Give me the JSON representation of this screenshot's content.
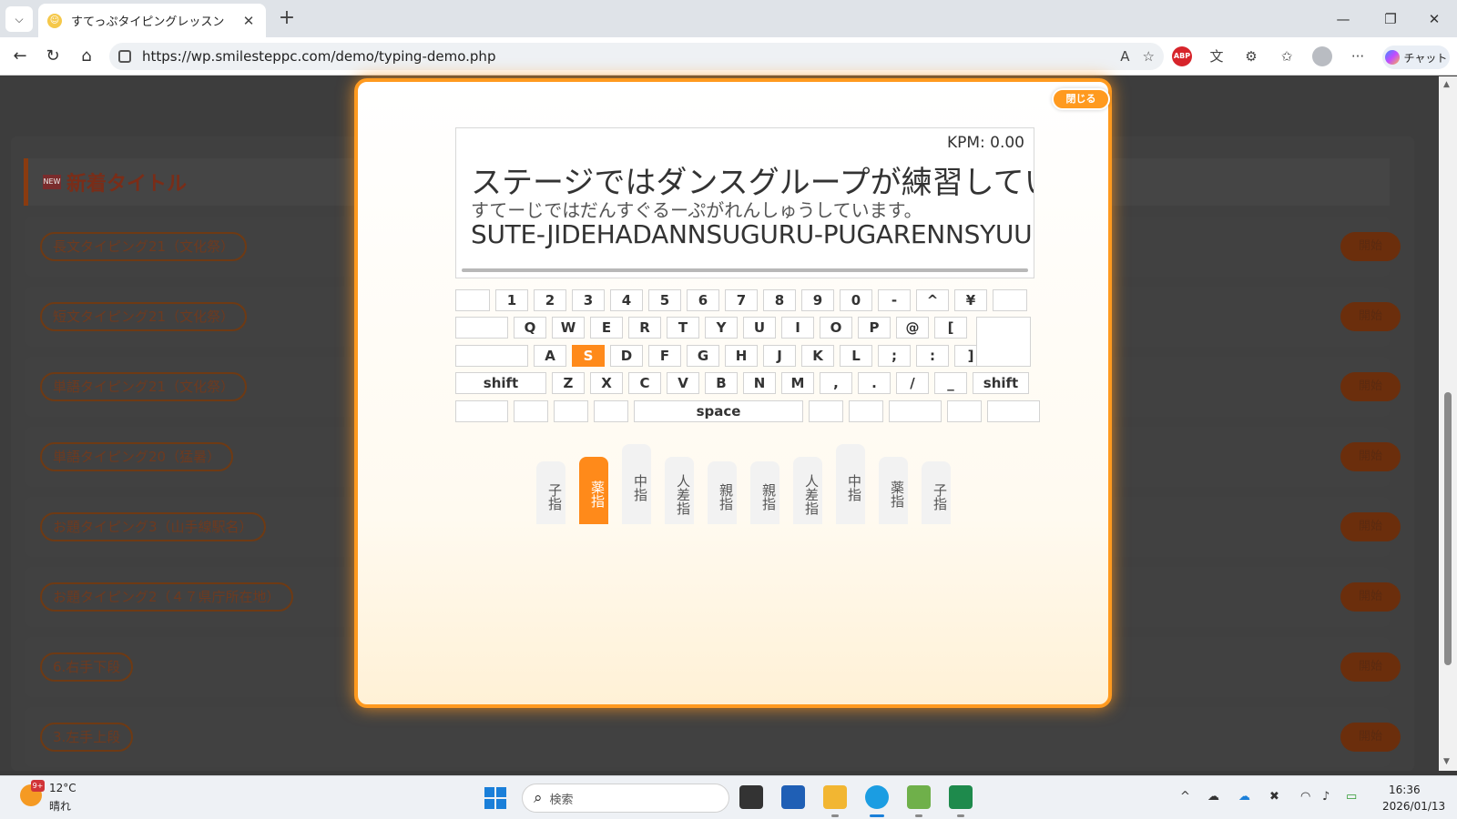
{
  "browser": {
    "tab_title": "すてっぷタイピングレッスン",
    "tab_favicon": "☺",
    "tab_list_icon": "⌵",
    "tab_close": "✕",
    "new_tab": "+",
    "url": "https://wp.smilesteppc.com/demo/typing-demo.php",
    "window_minimize": "—",
    "window_restore": "❐",
    "window_close": "✕",
    "back": "←",
    "reload": "↻",
    "home": "⌂",
    "read_aloud": "A",
    "favorite": "☆",
    "abp": "ABP",
    "translate": "文",
    "extensions": "⚙",
    "favorites_bar": "✩",
    "more": "···",
    "chat_label": "チャット"
  },
  "page": {
    "section_title": "新着タイトル",
    "new_badge": "NEW",
    "rows": [
      {
        "label": "長文タイピング21（文化祭）",
        "start": "開始"
      },
      {
        "label": "短文タイピング21（文化祭）",
        "start": "開始"
      },
      {
        "label": "単語タイピング21（文化祭）",
        "start": "開始"
      },
      {
        "label": "単語タイピング20（猛暑）",
        "start": "開始"
      },
      {
        "label": "お題タイピング3（山手線駅名）",
        "start": "開始"
      },
      {
        "label": "お題タイピング2（４７県庁所在地）",
        "start": "開始"
      },
      {
        "label": "6.右手下段",
        "start": "開始"
      },
      {
        "label": "3.左手上段",
        "start": "開始"
      }
    ]
  },
  "modal": {
    "close_label": "閉じる",
    "kpm": "KPM: 0.00",
    "sentence": "ステージではダンスグループが練習していま",
    "kana": "すてーじではだんすぐるーぷがれんしゅうしています。",
    "romaji": "SUTE-JIDEHADANNSUGURU-PUGARENNSYUU",
    "progress": 0,
    "accent_color": "#ff8a1a",
    "keyboard": {
      "row1": [
        "",
        "1",
        "2",
        "3",
        "4",
        "5",
        "6",
        "7",
        "8",
        "9",
        "0",
        "-",
        "^",
        "¥",
        ""
      ],
      "row2": [
        "",
        "Q",
        "W",
        "E",
        "R",
        "T",
        "Y",
        "U",
        "I",
        "O",
        "P",
        "@",
        "["
      ],
      "row3": [
        "",
        "A",
        "S",
        "D",
        "F",
        "G",
        "H",
        "J",
        "K",
        "L",
        ";",
        ":",
        "]"
      ],
      "row4": [
        "shift",
        "Z",
        "X",
        "C",
        "V",
        "B",
        "N",
        "M",
        ",",
        ".",
        "/",
        "_",
        "shift"
      ],
      "row5": [
        "",
        "",
        "",
        "",
        "space",
        "",
        "",
        "",
        "",
        ""
      ],
      "active_key": "S"
    },
    "fingers": [
      "子指",
      "薬指",
      "中指",
      "人差指",
      "親指",
      "親指",
      "人差指",
      "中指",
      "薬指",
      "子指"
    ],
    "active_finger": 1
  },
  "taskbar": {
    "weather_temp": "12°C",
    "weather_desc": "晴れ",
    "weather_badge": "9+",
    "search_placeholder": "検索",
    "time": "16:36",
    "date": "2026/01/13"
  }
}
